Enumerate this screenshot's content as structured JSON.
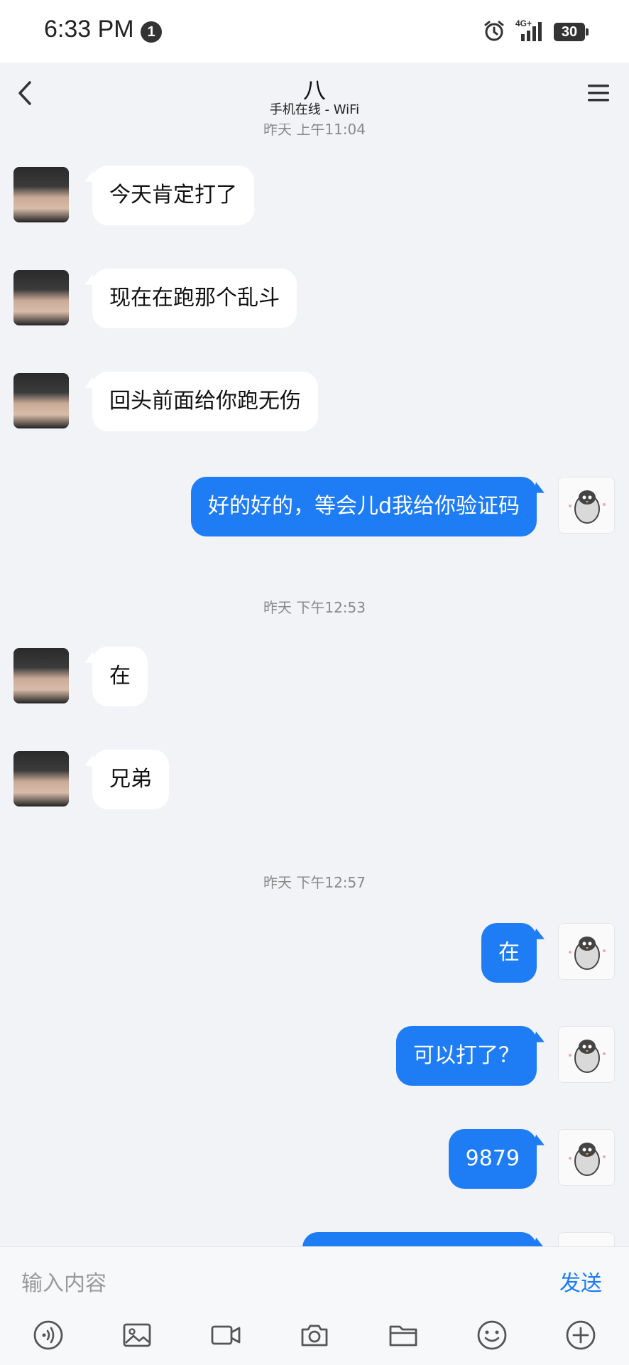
{
  "status_bar": {
    "time": "6:33 PM",
    "notification_count": "1",
    "network": "4G+",
    "battery": "30",
    "icons": [
      "alarm-icon",
      "signal-icon",
      "battery-icon"
    ]
  },
  "header": {
    "title": "八",
    "subtitle": "手机在线 - WiFi",
    "back_icon": "chevron-left-icon",
    "menu_icon": "hamburger-menu-icon"
  },
  "chat": {
    "timestamps": [
      "昨天 上午11:04",
      "昨天 下午12:53",
      "昨天 下午12:57"
    ],
    "messages": [
      {
        "sender": "other",
        "text": "今天肯定打了"
      },
      {
        "sender": "other",
        "text": "现在在跑那个乱斗"
      },
      {
        "sender": "other",
        "text": "回头前面给你跑无伤"
      },
      {
        "sender": "me",
        "text": "好的好的，等会儿d我给你验证码"
      },
      {
        "sender": "other",
        "text": "在"
      },
      {
        "sender": "other",
        "text": "兄弟"
      },
      {
        "sender": "me",
        "text": "在"
      },
      {
        "sender": "me",
        "text": "可以打了？"
      },
      {
        "sender": "me",
        "text": "9879"
      }
    ]
  },
  "input": {
    "placeholder": "输入内容",
    "send_label": "发送"
  },
  "toolbar": {
    "tools": [
      "voice-icon",
      "image-icon",
      "video-icon",
      "camera-icon",
      "folder-icon",
      "emoji-icon",
      "plus-icon"
    ]
  },
  "colors": {
    "accent": "#1e7cf5",
    "background": "#f2f3f7",
    "incoming_bubble": "#ffffff"
  }
}
